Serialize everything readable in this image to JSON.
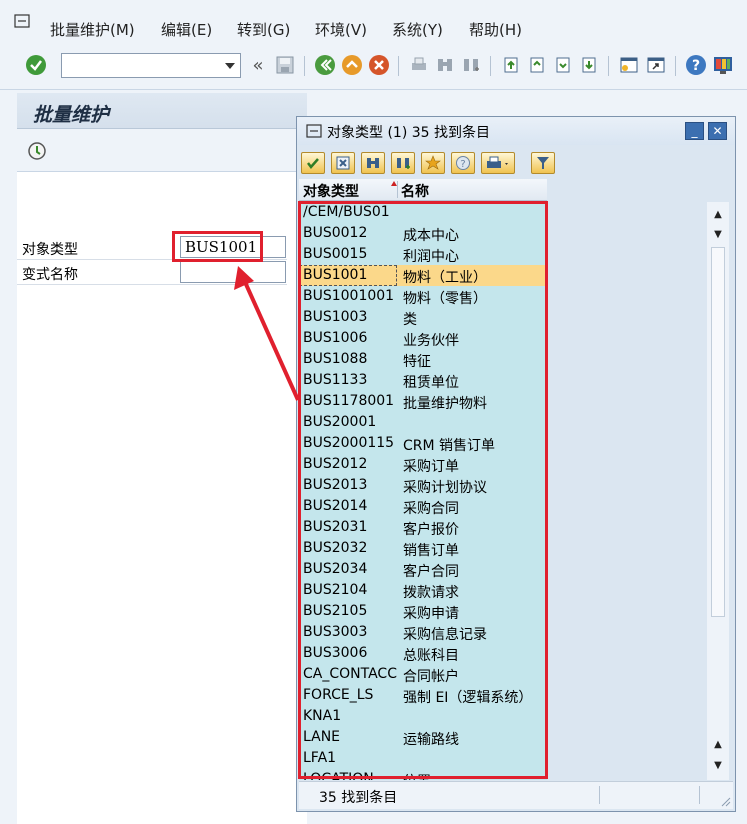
{
  "menu": {
    "items": [
      "批量维护(M)",
      "编辑(E)",
      "转到(G)",
      "环境(V)",
      "系统(Y)",
      "帮助(H)"
    ]
  },
  "toolbar": {
    "icons": [
      "enter-icon",
      "back-icon",
      "save-icon",
      "back-green-icon",
      "exit-icon",
      "cancel-icon",
      "print-icon",
      "find-icon",
      "find-next-icon",
      "first-page-icon",
      "prev-page-icon",
      "next-page-icon",
      "last-page-icon",
      "new-session-icon",
      "shortcut-icon",
      "help-icon",
      "layout-icon"
    ]
  },
  "page": {
    "title": "批量维护"
  },
  "form": {
    "object_type_label": "对象类型",
    "object_type_value": "BUS1001",
    "variant_label": "变式名称",
    "variant_value": ""
  },
  "popup": {
    "title": "对象类型 (1)   35 找到条目",
    "minimize": "_",
    "close": "✕",
    "col_object_type": "对象类型",
    "col_name": "名称",
    "status": "35 找到条目",
    "rows": [
      {
        "k": "/CEM/BUS01",
        "n": ""
      },
      {
        "k": "BUS0012",
        "n": "成本中心"
      },
      {
        "k": "BUS0015",
        "n": "利润中心"
      },
      {
        "k": "BUS1001",
        "n": "物料（工业）"
      },
      {
        "k": "BUS1001001",
        "n": "物料（零售）"
      },
      {
        "k": "BUS1003",
        "n": "类"
      },
      {
        "k": "BUS1006",
        "n": "业务伙伴"
      },
      {
        "k": "BUS1088",
        "n": "特征"
      },
      {
        "k": "BUS1133",
        "n": "租赁单位"
      },
      {
        "k": "BUS1178001",
        "n": "批量维护物料"
      },
      {
        "k": "BUS20001",
        "n": ""
      },
      {
        "k": "BUS2000115",
        "n": "CRM 销售订单"
      },
      {
        "k": "BUS2012",
        "n": "采购订单"
      },
      {
        "k": "BUS2013",
        "n": "采购计划协议"
      },
      {
        "k": "BUS2014",
        "n": "采购合同"
      },
      {
        "k": "BUS2031",
        "n": "客户报价"
      },
      {
        "k": "BUS2032",
        "n": "销售订单"
      },
      {
        "k": "BUS2034",
        "n": "客户合同"
      },
      {
        "k": "BUS2104",
        "n": "拨款请求"
      },
      {
        "k": "BUS2105",
        "n": "采购申请"
      },
      {
        "k": "BUS3003",
        "n": "采购信息记录"
      },
      {
        "k": "BUS3006",
        "n": "总账科目"
      },
      {
        "k": "CA_CONTACC",
        "n": "合同帐户"
      },
      {
        "k": "FORCE_LS",
        "n": "强制 EI（逻辑系统）"
      },
      {
        "k": "KNA1",
        "n": ""
      },
      {
        "k": "LANE",
        "n": "运输路线"
      },
      {
        "k": "LFA1",
        "n": ""
      },
      {
        "k": "LOCATION",
        "n": "位置"
      }
    ],
    "selected_key": "BUS1001"
  },
  "colors": {
    "highlight": "#e0202e",
    "list_bg": "#c4e6ec",
    "selected_row": "#fbd88a"
  }
}
